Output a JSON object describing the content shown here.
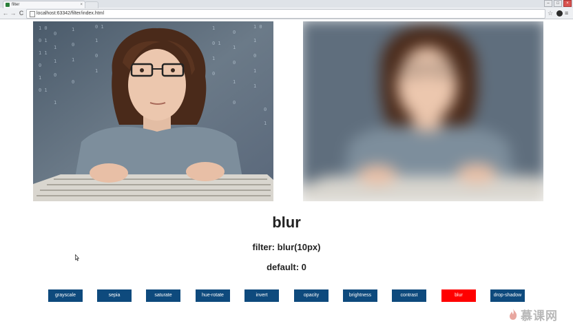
{
  "browser": {
    "tab_title": "filter",
    "tab_close": "×",
    "url": "localhost:63342/filter/index.html",
    "back_glyph": "←",
    "forward_glyph": "→",
    "reload_glyph": "C",
    "star_glyph": "☆",
    "menu_glyph": "≡",
    "window_buttons": [
      "–",
      "□",
      "×"
    ]
  },
  "images": {
    "left": {
      "icon": "boy-at-keyboard-photo",
      "filter": "none"
    },
    "right": {
      "icon": "boy-at-keyboard-photo",
      "filter": "blur(10px)"
    }
  },
  "info": {
    "filter_name": "blur",
    "filter_value": "filter: blur(10px)",
    "default_value": "default: 0"
  },
  "buttons": [
    {
      "label": "grayscale",
      "active": false
    },
    {
      "label": "sepia",
      "active": false
    },
    {
      "label": "saturate",
      "active": false
    },
    {
      "label": "hue-rotate",
      "active": false
    },
    {
      "label": "invert",
      "active": false
    },
    {
      "label": "opacity",
      "active": false
    },
    {
      "label": "brightness",
      "active": false
    },
    {
      "label": "contrast",
      "active": false
    },
    {
      "label": "blur",
      "active": true
    },
    {
      "label": "drop-shadow",
      "active": false
    }
  ],
  "colors": {
    "button_bg": "#0e4a7d",
    "button_active_bg": "#ff0000",
    "button_text": "#ffffff"
  },
  "watermark": {
    "text": "慕课网"
  }
}
